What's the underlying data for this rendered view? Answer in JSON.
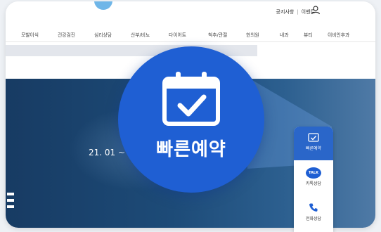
{
  "header": {
    "top_links": [
      "공지사항",
      "이벤트"
    ],
    "separator": "|"
  },
  "nav": {
    "items": [
      "모발이식",
      "건강검진",
      "심리상담",
      "산부/비뇨",
      "다이어트",
      "척추/관절",
      "한의원",
      "내과",
      "뷰티",
      "이비인후과"
    ]
  },
  "hero": {
    "date_text": "21. 01 ~"
  },
  "quick_reservation": {
    "label": "빠른예약"
  },
  "quick_bar": {
    "items": [
      {
        "label": "빠른예약",
        "icon": "calendar-check-icon"
      },
      {
        "label": "카톡상담",
        "icon": "talk-icon",
        "badge": "TALK"
      },
      {
        "label": "전화상담",
        "icon": "phone-icon"
      }
    ]
  },
  "colors": {
    "primary_blue": "#1f5fd3",
    "hero_navy": "#173b63",
    "white": "#ffffff"
  }
}
